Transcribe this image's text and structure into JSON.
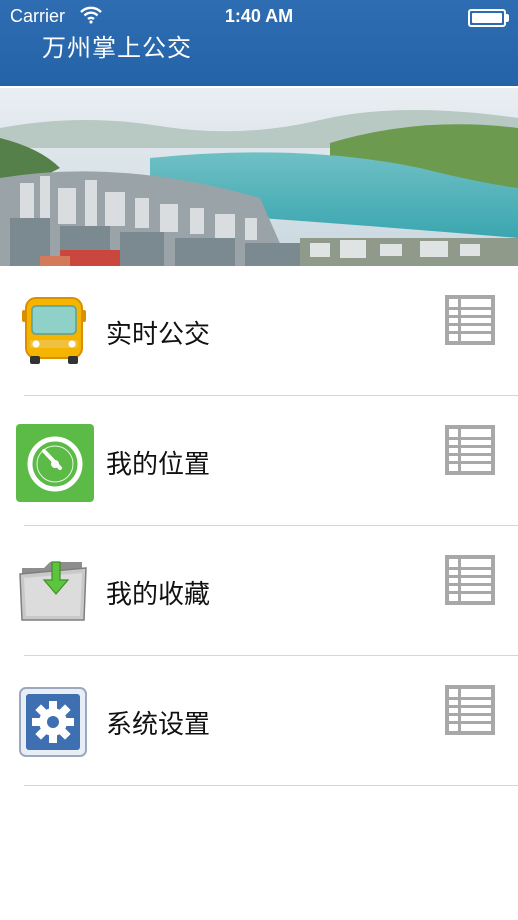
{
  "status_bar": {
    "carrier": "Carrier",
    "time": "1:40 AM"
  },
  "header": {
    "title": "万州掌上公交",
    "color": "#2463a8"
  },
  "banner": {
    "page_count": 1,
    "active_page": 1
  },
  "menu": {
    "items": [
      {
        "label": "实时公交",
        "icon": "bus-icon"
      },
      {
        "label": "我的位置",
        "icon": "gauge-icon"
      },
      {
        "label": "我的收藏",
        "icon": "folder-download-icon"
      },
      {
        "label": "系统设置",
        "icon": "gear-icon"
      }
    ],
    "trailing_icon": "list-icon"
  }
}
